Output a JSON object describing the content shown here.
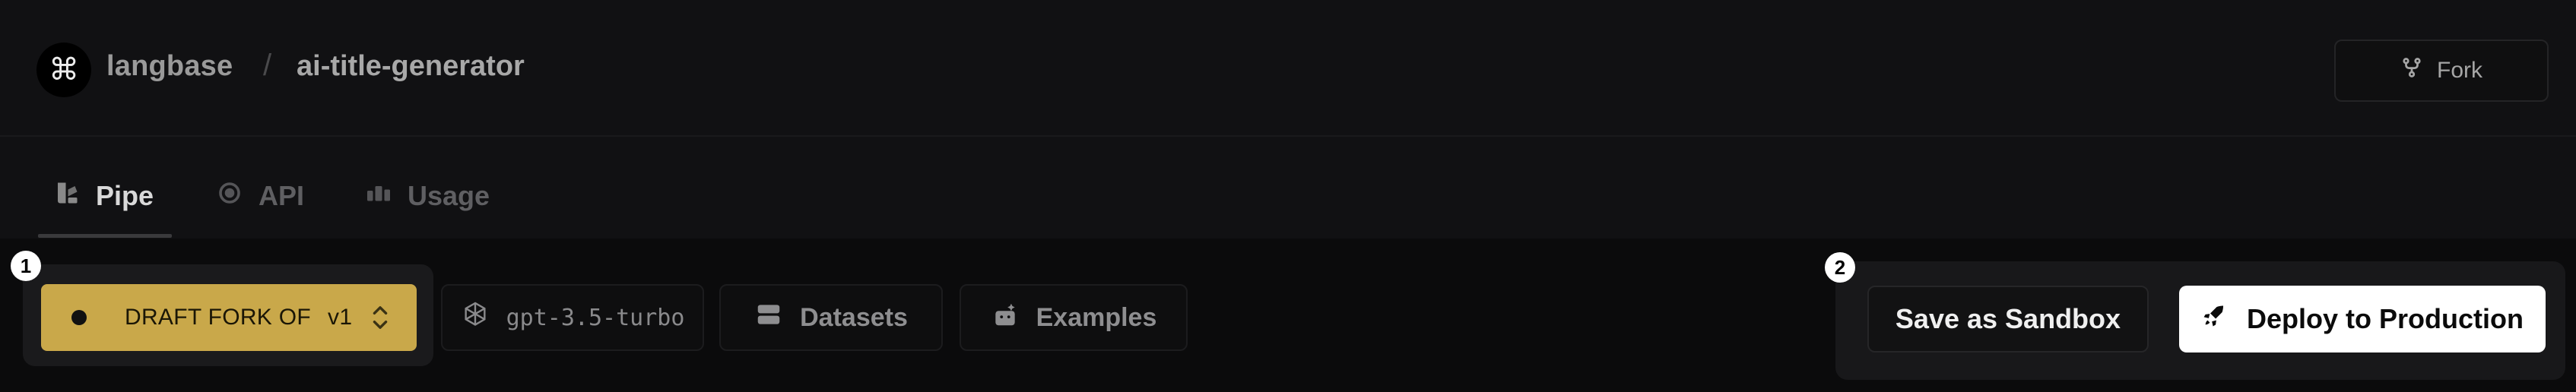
{
  "header": {
    "logo_glyph": "⌘",
    "org": "langbase",
    "separator": "/",
    "pipe_name": "ai-title-generator",
    "fork_label": "Fork"
  },
  "tabs": [
    {
      "label": "Pipe",
      "icon": "pipe-icon",
      "active": true
    },
    {
      "label": "API",
      "icon": "api-icon",
      "active": false
    },
    {
      "label": "Usage",
      "icon": "usage-icon",
      "active": false
    }
  ],
  "toolbar": {
    "left_step": "1",
    "right_step": "2",
    "version_status": "DRAFT FORK OF",
    "version": "v1",
    "model": "gpt-3.5-turbo",
    "datasets_label": "Datasets",
    "examples_label": "Examples",
    "sandbox_label": "Save as Sandbox",
    "deploy_label": "Deploy to Production"
  },
  "colors": {
    "version_accent": "#c9a84a",
    "background": "#0d0d0e",
    "primary_button": "#ffffff"
  }
}
